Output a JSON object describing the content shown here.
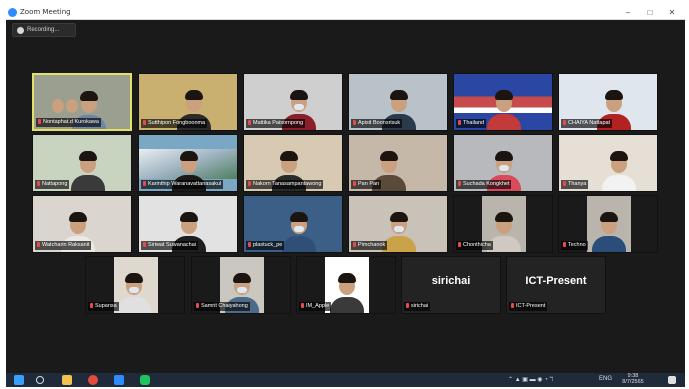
{
  "window": {
    "title": "Zoom Meeting",
    "controls": [
      "–",
      "□",
      "✕"
    ]
  },
  "recording": {
    "label": "Recording..."
  },
  "participants": [
    {
      "name": "Nontaphat.d Kurokawa",
      "muted": true,
      "active": true
    },
    {
      "name": "Sutthipon Fongboonma",
      "muted": true
    },
    {
      "name": "Mattika Paisornpong",
      "muted": true
    },
    {
      "name": "Apisit Boonsrisuk",
      "muted": true
    },
    {
      "name": "Thailand",
      "muted": true
    },
    {
      "name": "CHAIYA Nattapat",
      "muted": true
    },
    {
      "name": "Nattapong",
      "muted": true
    },
    {
      "name": "Karinthip Waranavattanasakul",
      "muted": true
    },
    {
      "name": "Nakorn Tanasampantawong",
      "muted": true
    },
    {
      "name": "Pan Pan",
      "muted": true
    },
    {
      "name": "Suchada Kongkhet",
      "muted": true
    },
    {
      "name": "Thanya",
      "muted": true
    },
    {
      "name": "Watcharin Raksanit",
      "muted": true
    },
    {
      "name": "Siriwat Suwanachai",
      "muted": true
    },
    {
      "name": "plastuck_pe",
      "muted": true
    },
    {
      "name": "Pimchanok",
      "muted": true
    },
    {
      "name": "Chonthicha",
      "muted": true
    },
    {
      "name": "Techno",
      "muted": true
    },
    {
      "name": "Supansa",
      "muted": true
    },
    {
      "name": "Samrit Chaiyahong",
      "muted": true
    },
    {
      "name": "IM_Apple",
      "muted": true
    },
    {
      "name": "sirichai",
      "muted": true,
      "video_off": true,
      "display": "sirichai"
    },
    {
      "name": "ICT-Present",
      "muted": true,
      "video_off": true,
      "display": "ICT-Present"
    }
  ],
  "taskbar": {
    "icons": [
      "windows-start-icon",
      "search-icon",
      "file-explorer-icon",
      "chrome-icon",
      "zoom-icon",
      "line-icon"
    ],
    "language": "ENG",
    "time": "9:38",
    "date": "8/7/2565"
  },
  "colors": {
    "active_border": "#e3e06a",
    "muted_red": "#e84a4a",
    "taskbar": "#1f2a3a"
  }
}
